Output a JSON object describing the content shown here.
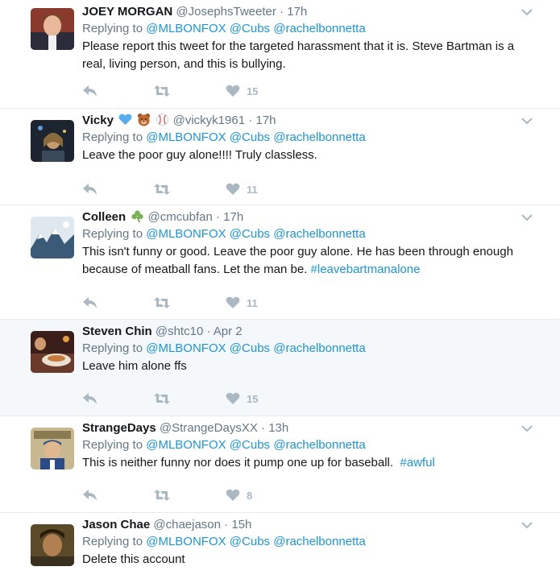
{
  "tweets": [
    {
      "name": "JOEY MORGAN",
      "handle": "@JosephsTweeter",
      "time": "17h",
      "replying_label": "Replying to",
      "mentions": [
        "@MLBONFOX",
        "@Cubs",
        "@rachelbonnetta"
      ],
      "text": "Please report this tweet for the targeted harassment that it is. Steve Bartman is a real, living person, and this is bullying.",
      "likes": "15"
    },
    {
      "name": "Vicky",
      "name_emojis": [
        "blue-heart-icon",
        "bear-icon",
        "baseball-icon"
      ],
      "handle": "@vickyk1961",
      "time": "17h",
      "replying_label": "Replying to",
      "mentions": [
        "@MLBONFOX",
        "@Cubs",
        "@rachelbonnetta"
      ],
      "text": "Leave the poor guy alone!!!! Truly classless.",
      "likes": "11"
    },
    {
      "name": "Colleen",
      "name_emojis": [
        "shamrock-icon"
      ],
      "handle": "@cmcubfan",
      "time": "17h",
      "replying_label": "Replying to",
      "mentions": [
        "@MLBONFOX",
        "@Cubs",
        "@rachelbonnetta"
      ],
      "text": "This isn't funny or good. Leave the poor guy alone. He has been through enough because of meatball fans. Let the man be.",
      "hashtag": "#leavebartmanalone",
      "likes": "11"
    },
    {
      "name": "Steven Chin",
      "handle": "@shtc10",
      "time": "Apr 2",
      "replying_label": "Replying to",
      "mentions": [
        "@MLBONFOX",
        "@Cubs",
        "@rachelbonnetta"
      ],
      "text": "Leave him alone ffs",
      "likes": "15",
      "highlighted": true
    },
    {
      "name": "StrangeDays",
      "handle": "@StrangeDaysXX",
      "time": "13h",
      "replying_label": "Replying to",
      "mentions": [
        "@MLBONFOX",
        "@Cubs",
        "@rachelbonnetta"
      ],
      "text": "This is neither funny nor does it pump one up for baseball.",
      "hashtag": "#awful",
      "likes": "8"
    },
    {
      "name": "Jason Chae",
      "handle": "@chaejason",
      "time": "15h",
      "replying_label": "Replying to",
      "mentions": [
        "@MLBONFOX",
        "@Cubs",
        "@rachelbonnetta"
      ],
      "text": "Delete this account"
    }
  ],
  "separator": "·",
  "colors": {
    "link": "#1b95e0",
    "muted": "#657786",
    "icon": "#aab8c2",
    "highlight_bg": "#f5f8fa"
  },
  "icons": {
    "reply": "reply-icon",
    "retweet": "retweet-icon",
    "like": "heart-icon",
    "more": "chevron-down-icon"
  }
}
